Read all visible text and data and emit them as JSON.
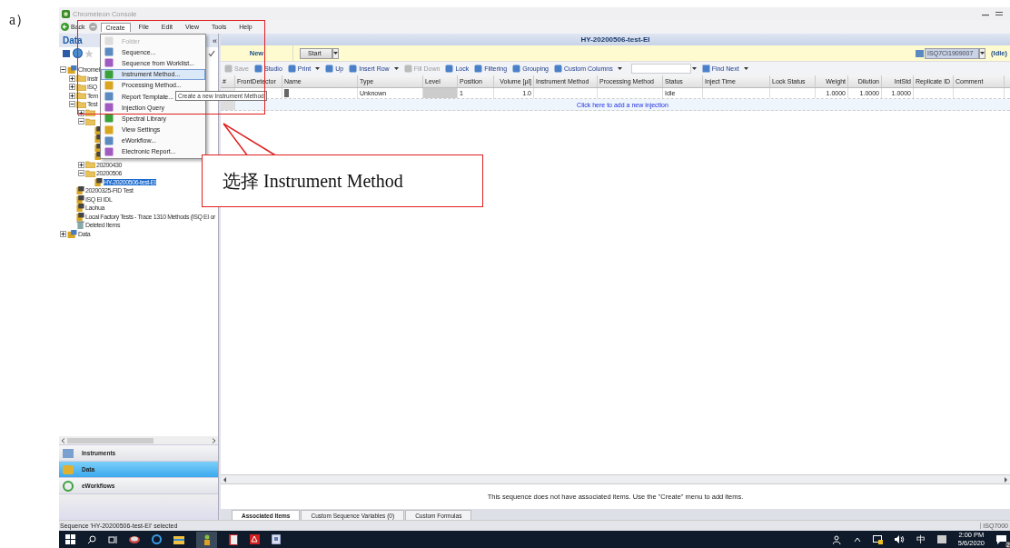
{
  "figure_label": "a）",
  "window": {
    "title": "Chromeleon Console"
  },
  "menubar": {
    "back": "Back",
    "menus": [
      {
        "label": "Create",
        "selected": true
      },
      {
        "label": "File",
        "selected": false
      },
      {
        "label": "Edit",
        "selected": false
      },
      {
        "label": "View",
        "selected": false
      },
      {
        "label": "Tools",
        "selected": false
      },
      {
        "label": "Help",
        "selected": false
      }
    ]
  },
  "create_menu": [
    {
      "label": "Folder",
      "disabled": true,
      "selected": false
    },
    {
      "label": "Sequence...",
      "disabled": false,
      "selected": false
    },
    {
      "label": "Sequence from Worklist...",
      "disabled": false,
      "selected": false
    },
    {
      "label": "Instrument Method...",
      "disabled": false,
      "selected": true
    },
    {
      "label": "Processing Method...",
      "disabled": false,
      "selected": false
    },
    {
      "label": "Report Template...",
      "disabled": false,
      "selected": false
    },
    {
      "label": "Injection Query",
      "disabled": false,
      "selected": false
    },
    {
      "label": "Spectral Library",
      "disabled": false,
      "selected": false
    },
    {
      "label": "View Settings",
      "disabled": false,
      "selected": false
    },
    {
      "label": "eWorkflow...",
      "disabled": false,
      "selected": false
    },
    {
      "label": "Electronic Report...",
      "disabled": false,
      "selected": false
    }
  ],
  "tooltip": "Create a new Instrument Method",
  "sidebar": {
    "title": "Data",
    "collapse": "«",
    "tree": [
      {
        "label": "Chromel",
        "kind": "root",
        "expanded": true,
        "selected": false,
        "children": [
          {
            "label": "Instr",
            "kind": "folder",
            "expanded": false,
            "selected": false
          },
          {
            "label": "ISQ",
            "kind": "folder",
            "expanded": false,
            "selected": false
          },
          {
            "label": "Tem",
            "kind": "folder",
            "expanded": false,
            "selected": false
          },
          {
            "label": "Test",
            "kind": "folder",
            "expanded": true,
            "selected": false,
            "children": [
              {
                "kind": "folder",
                "expanded": false
              },
              {
                "kind": "folder",
                "expanded": true,
                "children": [
                  {
                    "kind": "sequence"
                  },
                  {
                    "kind": "sequence"
                  },
                  {
                    "kind": "sequence"
                  },
                  {
                    "kind": "sequence"
                  }
                ]
              },
              {
                "label": "20200430",
                "kind": "folder",
                "expanded": false,
                "selected": false
              },
              {
                "label": "20200506",
                "kind": "folder",
                "expanded": true,
                "selected": false,
                "children": [
                  {
                    "label": "HY-20200506-test-EI",
                    "kind": "sequence",
                    "selected": true
                  }
                ]
              }
            ]
          },
          {
            "label": "20200325-FID Test",
            "kind": "sequence",
            "selected": false
          },
          {
            "label": "ISQ EI IDL",
            "kind": "sequence",
            "selected": false
          },
          {
            "label": "Laohua",
            "kind": "sequence",
            "selected": false
          },
          {
            "label": "Local Factory Tests - Trace 1310 Methods (ISQ EI or",
            "kind": "sequence",
            "selected": false
          },
          {
            "label": "Deleted Items",
            "kind": "trash",
            "selected": false
          }
        ]
      },
      {
        "label": "Data",
        "kind": "root",
        "expanded": false,
        "selected": false
      }
    ],
    "nav": [
      {
        "label": "Instruments",
        "selected": false
      },
      {
        "label": "Data",
        "selected": true
      },
      {
        "label": "eWorkflows",
        "selected": false
      }
    ]
  },
  "sequence": {
    "title": "HY-20200506-test-EI",
    "new": "New",
    "start": "Start",
    "instrument": "ISQ7CI1909007",
    "instrument_status": "(Idle)",
    "toolbar": [
      {
        "label": "Save",
        "disabled": true,
        "dropdown": false
      },
      {
        "label": "Studio",
        "disabled": false,
        "dropdown": false
      },
      {
        "label": "Print",
        "disabled": false,
        "dropdown": true
      },
      {
        "label": "Up",
        "disabled": false,
        "dropdown": false
      },
      {
        "label": "Insert Row",
        "disabled": false,
        "dropdown": true
      },
      {
        "label": "Fill Down",
        "disabled": true,
        "dropdown": false
      },
      {
        "label": "Lock",
        "disabled": false,
        "dropdown": false
      },
      {
        "label": "Filtering",
        "disabled": false,
        "dropdown": false
      },
      {
        "label": "Grouping",
        "disabled": false,
        "dropdown": false
      },
      {
        "label": "Custom Columns",
        "disabled": false,
        "dropdown": true
      }
    ],
    "find_next": "Find Next",
    "table": {
      "columns": [
        {
          "label": "#",
          "numeric": false
        },
        {
          "label": "FrontDetector",
          "numeric": false
        },
        {
          "label": "Name",
          "numeric": false
        },
        {
          "label": "Type",
          "numeric": false
        },
        {
          "label": "Level",
          "numeric": false
        },
        {
          "label": "Position",
          "numeric": false
        },
        {
          "label": "Volume [µl]",
          "numeric": true
        },
        {
          "label": "Instrument Method",
          "numeric": false
        },
        {
          "label": "Processing Method",
          "numeric": false
        },
        {
          "label": "Status",
          "numeric": false
        },
        {
          "label": "Inject Time",
          "numeric": false
        },
        {
          "label": "Lock Status",
          "numeric": false
        },
        {
          "label": "Weight",
          "numeric": true
        },
        {
          "label": "Dilution",
          "numeric": true
        },
        {
          "label": "IntStd",
          "numeric": true
        },
        {
          "label": "Replicate ID",
          "numeric": false
        },
        {
          "label": "Comment",
          "numeric": false
        }
      ],
      "rows": [
        [
          "",
          "",
          "",
          "Unknown",
          "",
          "1",
          "1.0",
          "",
          "",
          "Idle",
          "",
          "",
          "1.0000",
          "1.0000",
          "1.0000",
          "",
          ""
        ]
      ],
      "add_row": "Click here to add a new injection"
    },
    "associated_message": "This sequence does not have associated items. Use the \"Create\" menu to add items.",
    "tabs": [
      {
        "label": "Associated Items",
        "selected": true
      },
      {
        "label": "Custom Sequence Variables (0)",
        "selected": false
      },
      {
        "label": "Custom Formulas",
        "selected": false
      }
    ]
  },
  "status_bar": {
    "text": "Sequence 'HY-20200506-test-EI' selected",
    "right": "ISQ7000"
  },
  "taskbar": {
    "ime": "中",
    "time": "2:00 PM",
    "date": "5/6/2020",
    "notifications": "2"
  },
  "callout": "选择 Instrument Method"
}
